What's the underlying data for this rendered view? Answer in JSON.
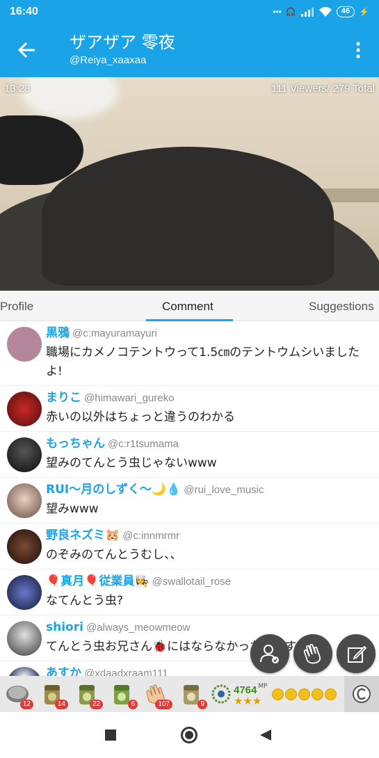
{
  "status": {
    "time": "16:40",
    "battery": "46"
  },
  "header": {
    "title": "ザアザア 零夜",
    "subtitle": "@Reiya_xaaxaa"
  },
  "video": {
    "elapsed": "13:23",
    "viewers": "111 Viewers/ 279 Total"
  },
  "tabs": [
    {
      "label": "Profile"
    },
    {
      "label": "Comment"
    },
    {
      "label": "Suggestions"
    }
  ],
  "comments": [
    {
      "name": "黒鴉",
      "handle": "@c:mayuramayuri",
      "text": "職場にカメノコテントウって1.5㎝のテントウムシいましたよ!",
      "avatar_color": "#b4869a"
    },
    {
      "name": "まりこ",
      "handle": "@himawari_gureko",
      "text": "赤いの以外はちょっと違うのわかる",
      "avatar_color": "#8b1a1a"
    },
    {
      "name": "もっちゃん",
      "handle": "@c:r1tsumama",
      "text": "望みのてんとう虫じゃないwww",
      "avatar_color": "#1b1b1b"
    },
    {
      "name": "RUI〜月のしずく〜🌙💧",
      "handle": "@rui_love_music",
      "text": "望みwww",
      "avatar_color": "#c9a999"
    },
    {
      "name": "野良ネズミ🐹",
      "handle": "@c:innmrmr",
      "text": "のぞみのてんとうむし、、",
      "avatar_color": "#3a1f15"
    },
    {
      "name": "🎈真月🎈従業員👩‍🍳",
      "handle": "@swallotail_rose",
      "text": "なてんとう虫?",
      "avatar_color": "#2b2f55"
    },
    {
      "name": "shiori",
      "handle": "@always_meowmeow",
      "text": "てんとう虫お兄さん🐞にはならなかったんですね、、",
      "avatar_color": "#6d6d6d"
    },
    {
      "name": "あすか",
      "handle": "@xdaadxraam111",
      "text": "",
      "avatar_color": "#1a2a5a"
    }
  ],
  "gifts": [
    {
      "icon": "coin-gift-icon",
      "count": "12"
    },
    {
      "icon": "tea-50-gift-icon",
      "count": "14"
    },
    {
      "icon": "tea-100-gift-icon",
      "count": "22"
    },
    {
      "icon": "tea-10-gift-icon",
      "count": "6"
    },
    {
      "icon": "clap-gift-icon",
      "count": "107"
    },
    {
      "icon": "tea-gift-icon",
      "count": "9"
    }
  ],
  "points": {
    "value": "4764",
    "unit": "MP",
    "stars": "★★★"
  },
  "colors": {
    "accent": "#1aa3e6",
    "name": "#1aa3e6",
    "badge": "#e53935"
  }
}
